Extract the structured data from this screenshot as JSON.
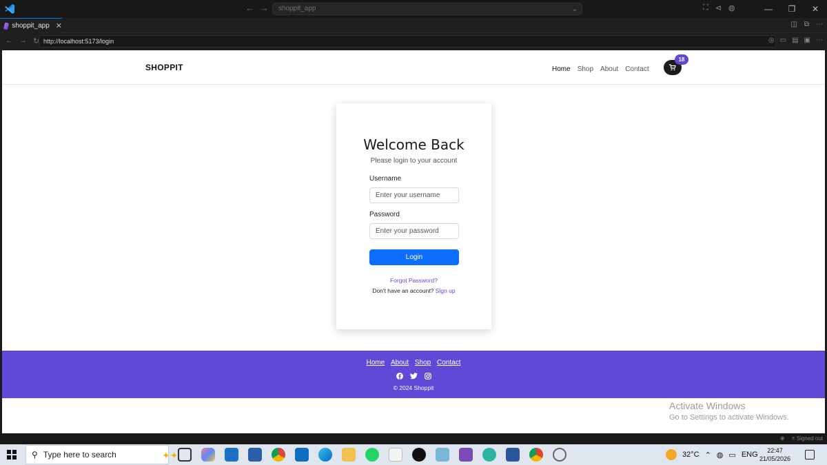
{
  "editor": {
    "command_center": "shoppit_app",
    "tab_label": "shoppit_app",
    "url": "http://localhost:5173/login"
  },
  "site": {
    "brand": "SHOPPIT",
    "nav": [
      "Home",
      "Shop",
      "About",
      "Contact"
    ],
    "cart_count": "18"
  },
  "login": {
    "title": "Welcome Back",
    "subtitle": "Please login to your account",
    "username_label": "Username",
    "username_placeholder": "Enter your username",
    "password_label": "Password",
    "password_placeholder": "Enter your password",
    "login_button": "Login",
    "forgot_link": "Forgot Password?",
    "no_account_text": "Don't have an account?",
    "signup_link": "Sign up"
  },
  "footer": {
    "links": [
      "Home",
      "About",
      "Shop",
      "Contact"
    ],
    "copyright": "© 2024 Shoppit"
  },
  "watermark": {
    "line1": "Activate Windows",
    "line2": "Go to Settings to activate Windows."
  },
  "statusbar": {
    "signed_out": "Signed out"
  },
  "taskbar": {
    "search_placeholder": "Type here to search",
    "temperature": "32°C",
    "language": "ENG",
    "time": "22:47",
    "date": "21/05/2026"
  },
  "colors": {
    "accent": "#5e4ad6",
    "primary_button": "#0d6efd"
  }
}
